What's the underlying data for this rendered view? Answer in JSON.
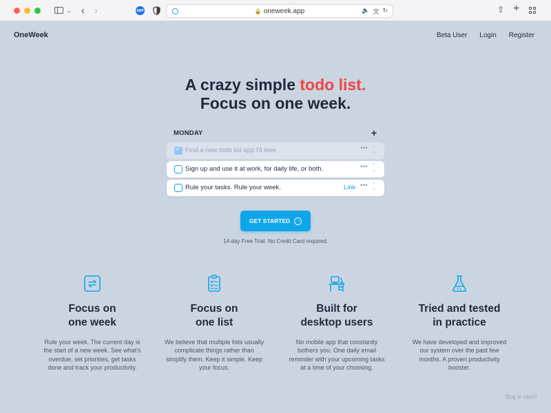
{
  "browser": {
    "url": "oneweek.app",
    "extension_badge": "ABP",
    "accent": "#1ba1e2"
  },
  "header": {
    "brand": "OneWeek",
    "nav": [
      "Beta User",
      "Login",
      "Register"
    ]
  },
  "hero": {
    "line1_prefix": "A crazy simple ",
    "line1_accent": "todo list.",
    "line2": "Focus on one week.",
    "accent_color": "#ef4444"
  },
  "todo": {
    "day": "MONDAY",
    "add_glyph": "+",
    "tasks": [
      {
        "label": "Find a new todo list app I'll love.",
        "done": true
      },
      {
        "label": "Sign up and use it at work, for daily life, or both.",
        "done": false
      },
      {
        "label": "Rule your tasks. Rule your week.",
        "done": false,
        "link": "Link"
      }
    ]
  },
  "cta": {
    "label": "GET STARTED",
    "note": "14-day Free Trial. No Credit Card required.",
    "color": "#0ea5e9"
  },
  "features": [
    {
      "icon": "repeat-icon",
      "title_line1": "Focus on",
      "title_line2": "one week",
      "desc": "Rule your week. The current day is the start of a new week. See what's overdue, set priorities, get tasks done and track your productivity."
    },
    {
      "icon": "checklist-icon",
      "title_line1": "Focus on",
      "title_line2": "one list",
      "desc": "We believe that multiple lists usually complicate things rather than simplify them. Keep it simple. Keep your focus."
    },
    {
      "icon": "desk-icon",
      "title_line1": "Built for",
      "title_line2": "desktop users",
      "desc": "No mobile app that constantly bothers you. One daily email reminder with your upcoming tasks at a time of your choosing."
    },
    {
      "icon": "flask-icon",
      "title_line1": "Tried and tested",
      "title_line2": "in practice",
      "desc": "We have developed and improved our system over the past few months. A proven productivity booster."
    }
  ],
  "footer": {
    "bug_link": "Bug or Idea?"
  }
}
